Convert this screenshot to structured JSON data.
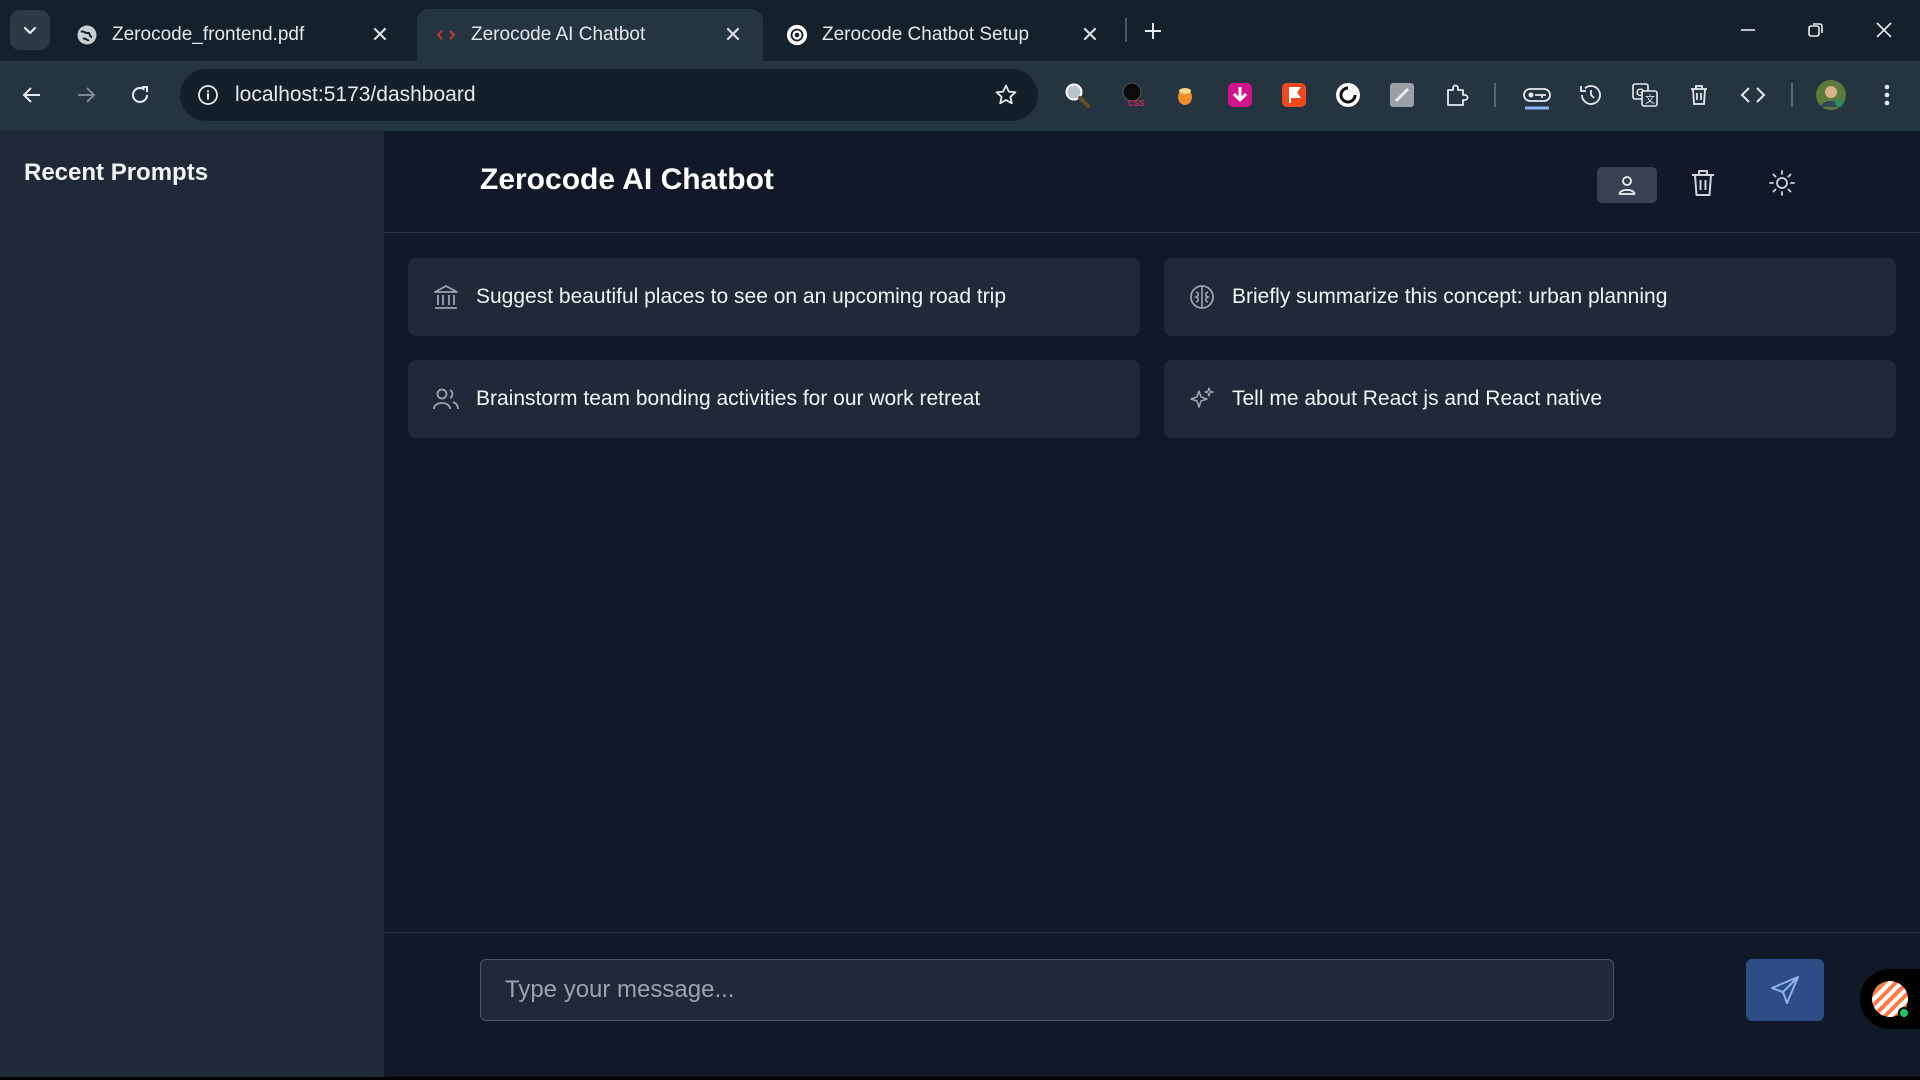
{
  "browser": {
    "tabs": [
      {
        "title": "Zerocode_frontend.pdf",
        "favicon": "globe-icon",
        "active": false
      },
      {
        "title": "Zerocode AI Chatbot",
        "favicon": "code-favicon-icon",
        "active": true
      },
      {
        "title": "Zerocode Chatbot Setup",
        "favicon": "openai-icon",
        "active": false
      }
    ],
    "url": "localhost:5173/dashboard",
    "extensions": [
      "search-icon",
      "css-icon",
      "acorn-icon",
      "download-icon",
      "flag-icon",
      "circle-icon",
      "pencil-icon",
      "puzzle-icon",
      "key-icon",
      "history-icon",
      "translate-icon",
      "trash-icon",
      "code-icon"
    ]
  },
  "sidebar": {
    "title": "Recent Prompts"
  },
  "header": {
    "title": "Zerocode AI Chatbot"
  },
  "suggestions": [
    {
      "text": "Suggest beautiful places to see on an upcoming road trip",
      "icon": "landmark-icon"
    },
    {
      "text": "Briefly summarize this concept: urban planning",
      "icon": "brain-icon"
    },
    {
      "text": "Brainstorm team bonding activities for our work retreat",
      "icon": "users-icon"
    },
    {
      "text": "Tell me about React js and React native",
      "icon": "sparkles-icon"
    }
  ],
  "composer": {
    "placeholder": "Type your message..."
  },
  "colors": {
    "app_bg": "#111827",
    "sidebar_bg": "#1f2937",
    "card_bg": "#1f2937",
    "send_button": "#2c4d86"
  }
}
